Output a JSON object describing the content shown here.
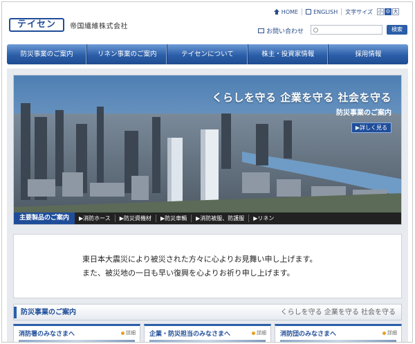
{
  "header": {
    "util": {
      "home": "HOME",
      "english": "ENGLISH",
      "font_size_label": "文字サイズ",
      "sizes": [
        "小",
        "中",
        "大"
      ]
    },
    "logo": {
      "mark": "テイセン",
      "company": "帝国繊維株式会社"
    },
    "contact": "お問い合わせ",
    "search": {
      "placeholder": "",
      "button": "検索"
    }
  },
  "nav": {
    "items": [
      "防災事業のご案内",
      "リネン事業のご案内",
      "テイセンについて",
      "株主・投資家情報",
      "採用情報"
    ]
  },
  "hero": {
    "tagline": "くらしを守る 企業を守る 社会を守る",
    "subtitle": "防災事業のご案内",
    "more": "▶詳しく見る",
    "products_title": "主要製品のご案内",
    "products": [
      "▶消防ホース",
      "▶防災資機材",
      "▶防災車輌",
      "▶消防被服、防護服",
      "▶リネン"
    ]
  },
  "message": {
    "line1": "東日本大震災により被災された方々に心よりお見舞い申し上げます。",
    "line2": "また、被災地の一日も早い復興を心よりお祈り申し上げます。"
  },
  "section": {
    "title": "防災事業のご案内",
    "slogan": "くらしを守る 企業を守る 社会を守る"
  },
  "cards": [
    {
      "title": "消防署のみなさまへ",
      "detail": "詳細"
    },
    {
      "title": "企業・防災担当のみなさまへ",
      "detail": "詳細"
    },
    {
      "title": "消防団のみなさまへ",
      "detail": "詳細"
    }
  ],
  "colors": {
    "brand": "#1f4d99",
    "nav": "#2b5ea8",
    "panel": "#e7eaef"
  }
}
